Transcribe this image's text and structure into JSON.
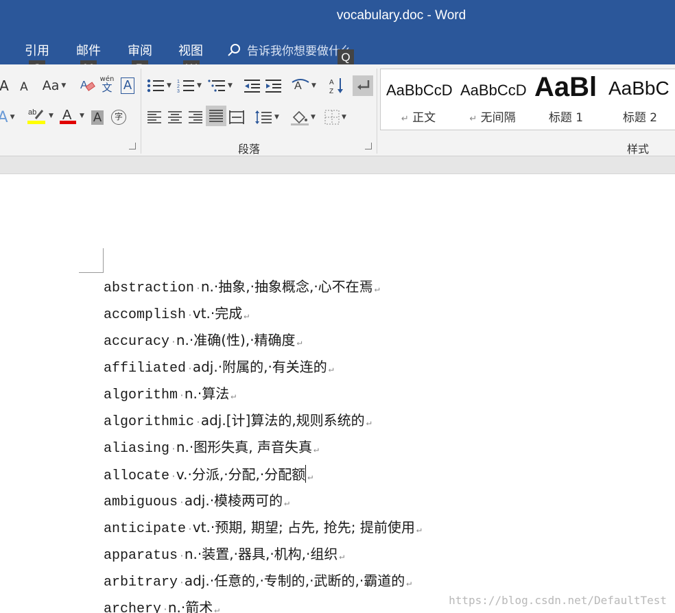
{
  "window": {
    "title": "vocabulary.doc  -  Word"
  },
  "tabs": [
    {
      "label": "引用",
      "keytip": "S"
    },
    {
      "label": "邮件",
      "keytip": "M"
    },
    {
      "label": "审阅",
      "keytip": "R"
    },
    {
      "label": "视图",
      "keytip": "W"
    }
  ],
  "search": {
    "placeholder": "告诉我你想要做什么",
    "keytip": "Q"
  },
  "ribbon": {
    "font_buttons": {
      "change_case": "Aa",
      "phonetic_top": "wén",
      "phonetic_bottom": "文",
      "char_border": "A",
      "enclose": "字"
    },
    "groups": {
      "paragraph": "段落",
      "styles": "样式"
    },
    "styles": [
      {
        "preview": "AaBbCcD",
        "name": "正文",
        "mark": "↵"
      },
      {
        "preview": "AaBbCcD",
        "name": "无间隔",
        "mark": "↵"
      },
      {
        "preview": "AaBl",
        "name": "标题 1"
      },
      {
        "preview": "AaBbC",
        "name": "标题 2"
      }
    ],
    "colors": {
      "highlight": "#ffff00",
      "font_color": "#e00000",
      "accent": "#2b579a"
    }
  },
  "document": {
    "entries": [
      {
        "word": "abstraction",
        "definition": "n.·抽象,·抽象概念,·心不在焉"
      },
      {
        "word": "accomplish",
        "definition": "vt.·完成"
      },
      {
        "word": "accuracy",
        "definition": "n.·准确(性),·精确度"
      },
      {
        "word": "affiliated",
        "definition": "adj.·附属的,·有关连的"
      },
      {
        "word": "algorithm",
        "definition": "n.·算法"
      },
      {
        "word": "algorithmic",
        "definition": "adj.[计]算法的,规则系统的"
      },
      {
        "word": "aliasing",
        "definition": "n.·图形失真, 声音失真"
      },
      {
        "word": "allocate",
        "definition": "v.·分派,·分配,·分配额"
      },
      {
        "word": "ambiguous",
        "definition": "adj.·模棱两可的"
      },
      {
        "word": "anticipate",
        "definition": "vt.·预期, 期望; 占先, 抢先; 提前使用"
      },
      {
        "word": "apparatus",
        "definition": "n.·装置,·器具,·机构,·组织"
      },
      {
        "word": "arbitrary",
        "definition": "adj.·任意的,·专制的,·武断的,·霸道的"
      },
      {
        "word": "archery",
        "definition": "n.·箭术"
      }
    ],
    "paragraph_mark": "↵",
    "watermark": "https://blog.csdn.net/DefaultTest"
  }
}
